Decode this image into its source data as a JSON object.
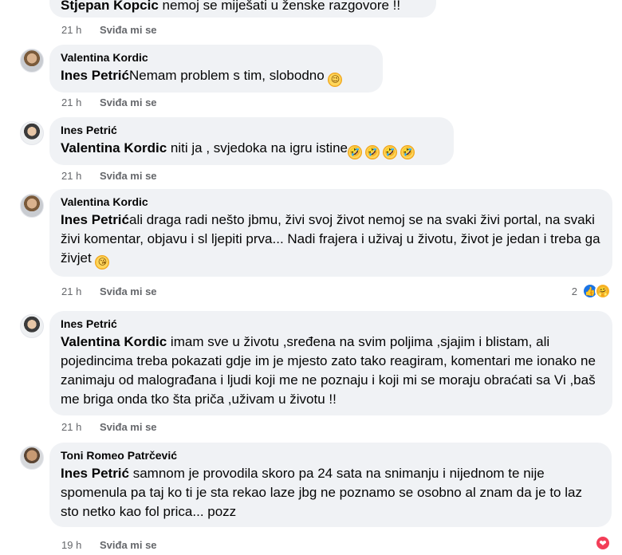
{
  "comments": [
    {
      "author": "Stjepan Kopcic",
      "text": "nemoj se miješati u ženske razgovore !!",
      "time": "21 h",
      "like_label": "Sviđa mi se"
    },
    {
      "author": "Valentina Kordic",
      "mention": "Ines Petrić",
      "text": "Nemam problem s tim, slobodno ",
      "time": "21 h",
      "like_label": "Sviđa mi se"
    },
    {
      "author": "Ines Petrić",
      "mention": "Valentina Kordic",
      "text": " niti ja , svjedoka na igru istine",
      "time": "21 h",
      "like_label": "Sviđa mi se"
    },
    {
      "author": "Valentina Kordic",
      "mention": "Ines Petrić",
      "text": "ali draga radi nešto jbmu, živi svoj život nemoj se na svaki živi portal, na svaki živi komentar, objavu i sl ljepiti prva... Nadi frajera i uživaj u životu, život je jedan i treba ga živjet ",
      "time": "21 h",
      "like_label": "Sviđa mi se",
      "reaction_count": "2"
    },
    {
      "author": "Ines Petrić",
      "mention": "Valentina Kordic",
      "text": " imam sve u životu ,sređena na svim poljima ,sjajim i blistam, ali pojedincima treba pokazati gdje im je mjesto zato tako reagiram, komentari me ionako ne zanimaju od malograđana i ljudi koji me ne poznaju i koji mi se moraju obraćati sa Vi ,baš me briga onda tko šta priča ,uživam u životu !!",
      "time": "21 h",
      "like_label": "Sviđa mi se"
    },
    {
      "author": "Toni Romeo Patrčević",
      "mention": "Ines Petrić",
      "text": " samnom je provodila skoro pa 24 sata na snimanju i nijednom te nije spomenula pa taj ko ti je sta rekao laze jbg ne poznamo se osobno al znam da je to laz sto netko kao fol prica... pozz",
      "time": "19 h",
      "like_label": "Sviđa mi se"
    }
  ],
  "icons": {
    "wink": "😉",
    "rofl": "🤣",
    "kiss": "😘",
    "like_reaction": "👍",
    "care_reaction": "🤗",
    "love_reaction": "❤"
  },
  "colors": {
    "bubble": "#f0f2f5",
    "meta": "#65676b",
    "like_blue": "#1b74e4",
    "love_red": "#f33e58"
  }
}
